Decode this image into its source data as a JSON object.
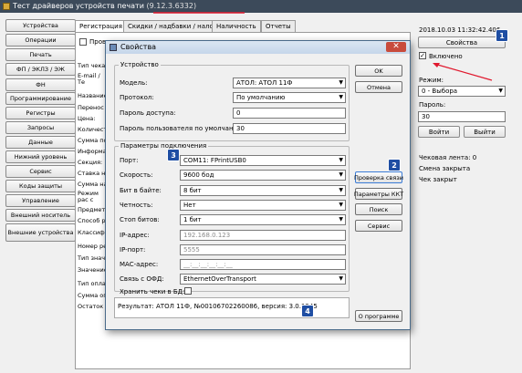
{
  "window": {
    "title_main": "Тест драйверов устройств печати",
    "title_version": "(9.12.3.6332)"
  },
  "sidebar": {
    "items": [
      "Устройства",
      "Операции",
      "Печать",
      "ФП / ЭКЛЗ / ЭЖ",
      "ФН",
      "Программирование",
      "Регистры",
      "Запросы",
      "Данные",
      "Нижний уровень",
      "Сервис",
      "Коды защиты",
      "Управление",
      "Внешний носитель",
      "Внешние устройства"
    ]
  },
  "tabs": [
    "Регистрация",
    "Скидки / надбавки / налоги",
    "Наличность",
    "Отчеты"
  ],
  "background_labels": [
    "Тип чека:",
    "E-mail / Те пользоват",
    "Название",
    "Перенос т",
    "Цена:",
    "Количест",
    "Сумма по",
    "Информац",
    "Секция:",
    "Ставка на",
    "Сумма на",
    "Режим рас с налогом",
    "Предмет р",
    "Способ ра",
    "Классифи",
    "Номер рег",
    "Тип значе",
    "Значение",
    "Тип оплат",
    "Сумма опл",
    "Остаток"
  ],
  "background_check_label": "Прове",
  "right_panel": {
    "datetime": "2018.10.03 11:32:42.406",
    "properties_button": "Свойства",
    "enabled_label": "Включено",
    "enabled_checked": true,
    "mode_label": "Режим:",
    "mode_value": "0 - Выбора",
    "password_label": "Пароль:",
    "password_value": "30",
    "enter_button": "Войти",
    "exit_button": "Выйти",
    "status_lines": [
      "Чековая лента: 0",
      "Смена закрыта",
      "Чек закрыт"
    ]
  },
  "dialog": {
    "title": "Свойства",
    "close_glyph": "✕",
    "device_group": "Устройство",
    "model_label": "Модель:",
    "model_value": "АТОЛ: АТОЛ 11Ф",
    "protocol_label": "Протокол:",
    "protocol_value": "По умолчанию",
    "access_password_label": "Пароль доступа:",
    "access_password_value": "0",
    "user_password_label": "Пароль пользователя по умолчанию:",
    "user_password_value": "30",
    "connection_group": "Параметры подключения",
    "port_label": "Порт:",
    "port_value": "COM11: FPrintUSB0",
    "speed_label": "Скорость:",
    "speed_value": "9600 бод",
    "bits_label": "Бит в байте:",
    "bits_value": "8 бит",
    "parity_label": "Четность:",
    "parity_value": "Нет",
    "stopbits_label": "Стоп битов:",
    "stopbits_value": "1 бит",
    "ip_label": "IP-адрес:",
    "ip_value": "192.168.0.123",
    "ipport_label": "IP-порт:",
    "ipport_value": "5555",
    "mac_label": "MAC-адрес:",
    "mac_value": "__:__:__:__:__:__",
    "ofd_label": "Связь с ОФД:",
    "ofd_value": "EthernetOverTransport",
    "store_label": "Хранить чеки в БД:",
    "buttons": {
      "ok": "OK",
      "cancel": "Отмена",
      "check": "Проверка связи",
      "kkt": "Параметры ККТ",
      "search": "Поиск",
      "service": "Сервис",
      "about": "О программе"
    },
    "result_text": "Результат:   АТОЛ 11Ф, №00106702260086, версия: 3.0.1245"
  },
  "markers": [
    "1",
    "2",
    "3",
    "4"
  ],
  "colors": {
    "marker": "#1f4ea3",
    "annotation": "#e0192e",
    "titlebar": "#3c4a5a"
  }
}
